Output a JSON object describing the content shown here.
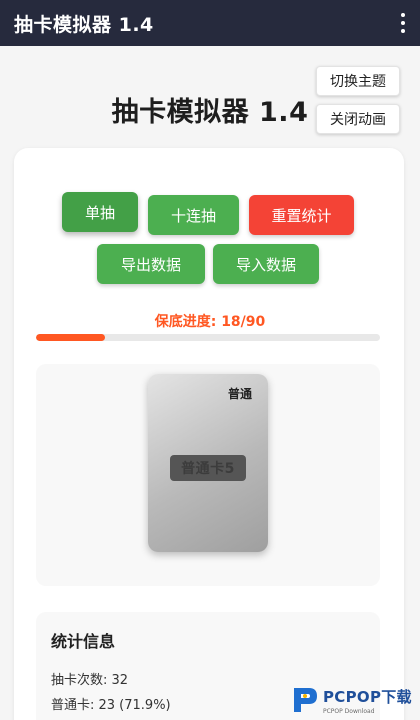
{
  "appbar": {
    "title": "抽卡模拟器 1.4"
  },
  "header": {
    "title": "抽卡模拟器 1.4"
  },
  "side_buttons": {
    "theme": "切换主题",
    "animation": "关闭动画"
  },
  "actions": {
    "single": "单抽",
    "ten": "十连抽",
    "reset": "重置统计",
    "export": "导出数据",
    "import": "导入数据"
  },
  "pity": {
    "label": "保底进度: 18/90",
    "current": 18,
    "max": 90
  },
  "card": {
    "rarity": "普通",
    "name": "普通卡5"
  },
  "stats": {
    "title": "统计信息",
    "draws": "抽卡次数: 32",
    "normal": "普通卡: 23 (71.9%)"
  },
  "watermark": {
    "brand": "PCPOP下载",
    "sub": "PCPOP Download"
  },
  "colors": {
    "appbar": "#262a3d",
    "primary": "#4caf50",
    "danger": "#f44336",
    "accent": "#ff5722"
  }
}
